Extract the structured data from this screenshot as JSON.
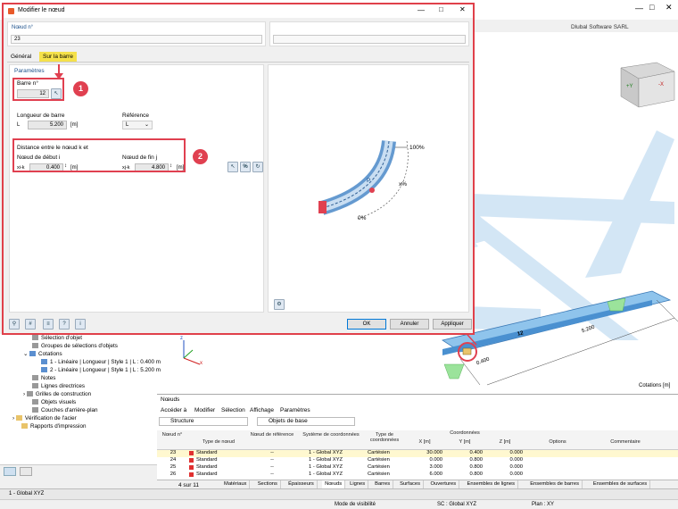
{
  "app": {
    "brand": "Dlubal Software SARL",
    "bottom_left": "1 - Global XYZ",
    "status": {
      "visibility": "Mode de visibilité",
      "sc": "SC : Global XYZ",
      "plan": "Plan : XY"
    },
    "cotations_label": "Cotations [m]"
  },
  "dialog": {
    "title": "Modifier le nœud",
    "node_no_label": "Nœud n°",
    "node_no_value": "23",
    "tabs": [
      "Général",
      "Sur la barre"
    ],
    "section_title": "Paramètres",
    "member_label": "Barre n°",
    "member_value": "12",
    "length_label": "Longueur de barre",
    "length_symbol": "L",
    "length_value": "5.200",
    "length_unit": "[m]",
    "reference_label": "Référence",
    "reference_value": "L",
    "distance_title": "Distance entre le nœud k et",
    "start_label": "Nœud de début i",
    "start_symbol": "xi-k",
    "start_value": "0.400",
    "start_unit": "[m]",
    "end_label": "Nœud de fin j",
    "end_symbol": "xj-k",
    "end_value": "4.800",
    "end_unit": "[m]",
    "pct_100": "100%",
    "pct_p": "P",
    "pct_x": "x%",
    "pct_0": "0%",
    "ok": "OK",
    "cancel": "Annuler",
    "apply": "Appliquer",
    "callout1": "1",
    "callout2": "2"
  },
  "tree": {
    "items": [
      "Sélection d'objet",
      "Groupes de sélections d'objets",
      "Cotations",
      "1 - Linéaire | Longueur | Style 1 | L : 0.400 m",
      "2 - Linéaire | Longueur | Style 1 | L : 5.200 m",
      "Notes",
      "Lignes directrices",
      "Grilles de construction",
      "Objets visuels",
      "Couches d'arrière-plan",
      "Vérification de l'acier",
      "Rapports d'impression"
    ]
  },
  "viewport": {
    "member_label": "12",
    "dim_5200": "5.200",
    "dim_0400": "0.400",
    "axis_x": "x",
    "axis_z": "z",
    "axis_y": "y",
    "cube_y": "+Y",
    "cube_x": "-X"
  },
  "table": {
    "title": "Nœuds",
    "menu": [
      "Accéder à",
      "Modifier",
      "Sélection",
      "Affichage",
      "Paramètres"
    ],
    "structure": "Structure",
    "object_type": "Objets de base",
    "headers": {
      "no": "Nœud n°",
      "type": "Type de nœud",
      "ref": "Nœud de référence",
      "cs": "Système de coordonnées",
      "ctype": "Type de coordonnées",
      "coords": "Coordonnées",
      "x": "X [m]",
      "y": "Y [m]",
      "z": "Z [m]",
      "options": "Options",
      "comment": "Commentaire"
    },
    "rows": [
      {
        "no": "23",
        "type": "Standard",
        "ref": "--",
        "cs": "1 - Global XYZ",
        "ctype": "Cartésien",
        "x": "30.000",
        "y": "0.400",
        "z": "0.000"
      },
      {
        "no": "24",
        "type": "Standard",
        "ref": "--",
        "cs": "1 - Global XYZ",
        "ctype": "Cartésien",
        "x": "0.000",
        "y": "0.800",
        "z": "0.000"
      },
      {
        "no": "25",
        "type": "Standard",
        "ref": "--",
        "cs": "1 - Global XYZ",
        "ctype": "Cartésien",
        "x": "3.000",
        "y": "0.800",
        "z": "0.000"
      },
      {
        "no": "26",
        "type": "Standard",
        "ref": "--",
        "cs": "1 - Global XYZ",
        "ctype": "Cartésien",
        "x": "6.000",
        "y": "0.800",
        "z": "0.000"
      }
    ],
    "pager": "4 sur 11",
    "bottom_tabs": [
      "Matériaux",
      "Sections",
      "Épaisseurs",
      "Nœuds",
      "Lignes",
      "Barres",
      "Surfaces",
      "Ouvertures",
      "Ensembles de lignes",
      "Ensembles de barres",
      "Ensembles de surfaces"
    ]
  },
  "colors": {
    "accent_red": "#e04050",
    "tab_yellow": "#f5e14a",
    "beam_blue": "#8fc4ec"
  }
}
